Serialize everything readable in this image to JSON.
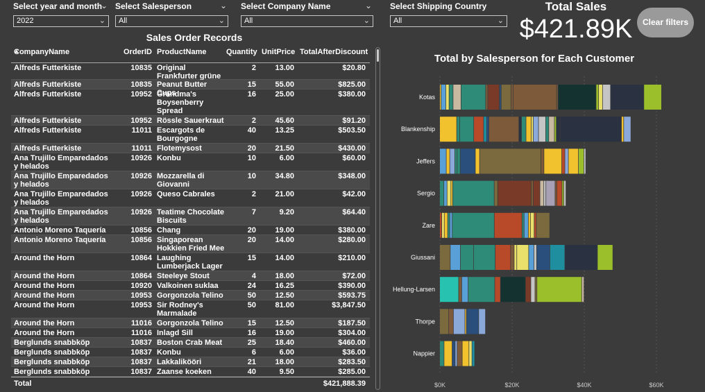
{
  "slicers": [
    {
      "label": "Select year and month",
      "value": "2022"
    },
    {
      "label": "Select Salesperson",
      "value": "All"
    },
    {
      "label": "Select Company Name",
      "value": "All"
    },
    {
      "label": "Select Shipping Country",
      "value": "All"
    }
  ],
  "kpi": {
    "label": "Total Sales",
    "value": "$421.89K"
  },
  "clear_button": "Clear filters",
  "table": {
    "title": "Sales Order Records",
    "columns": [
      "CompanyName",
      "OrderID",
      "ProductName",
      "Quantity",
      "UnitPrice",
      "TotalAfterDiscount"
    ],
    "rows": [
      {
        "company": "Alfreds Futterkiste",
        "id": "10835",
        "product": "Original Frankfurter grüne Soße",
        "qty": "2",
        "price": "13.00",
        "total": "$20.80"
      },
      {
        "company": "Alfreds Futterkiste",
        "id": "10835",
        "product": "Peanut Butter Cups",
        "qty": "15",
        "price": "55.00",
        "total": "$825.00"
      },
      {
        "company": "Alfreds Futterkiste",
        "id": "10952",
        "product": "Grandma's Boysenberry Spread",
        "qty": "16",
        "price": "25.00",
        "total": "$380.00"
      },
      {
        "company": "Alfreds Futterkiste",
        "id": "10952",
        "product": "Rössle Sauerkraut",
        "qty": "2",
        "price": "45.60",
        "total": "$91.20"
      },
      {
        "company": "Alfreds Futterkiste",
        "id": "11011",
        "product": "Escargots de Bourgogne",
        "qty": "40",
        "price": "13.25",
        "total": "$503.50"
      },
      {
        "company": "Alfreds Futterkiste",
        "id": "11011",
        "product": "Flotemysost",
        "qty": "20",
        "price": "21.50",
        "total": "$430.00"
      },
      {
        "company": "Ana Trujillo Emparedados y helados",
        "id": "10926",
        "product": "Konbu",
        "qty": "10",
        "price": "6.00",
        "total": "$60.00"
      },
      {
        "company": "Ana Trujillo Emparedados y helados",
        "id": "10926",
        "product": "Mozzarella di Giovanni",
        "qty": "10",
        "price": "34.80",
        "total": "$348.00"
      },
      {
        "company": "Ana Trujillo Emparedados y helados",
        "id": "10926",
        "product": "Queso Cabrales",
        "qty": "2",
        "price": "21.00",
        "total": "$42.00"
      },
      {
        "company": "Ana Trujillo Emparedados y helados",
        "id": "10926",
        "product": "Teatime Chocolate Biscuits",
        "qty": "7",
        "price": "9.20",
        "total": "$64.40"
      },
      {
        "company": "Antonio Moreno Taquería",
        "id": "10856",
        "product": "Chang",
        "qty": "20",
        "price": "19.00",
        "total": "$380.00"
      },
      {
        "company": "Antonio Moreno Taquería",
        "id": "10856",
        "product": "Singaporean Hokkien Fried Mee",
        "qty": "20",
        "price": "14.00",
        "total": "$280.00"
      },
      {
        "company": "Around the Horn",
        "id": "10864",
        "product": "Laughing Lumberjack Lager",
        "qty": "15",
        "price": "14.00",
        "total": "$210.00"
      },
      {
        "company": "Around the Horn",
        "id": "10864",
        "product": "Steeleye Stout",
        "qty": "4",
        "price": "18.00",
        "total": "$72.00"
      },
      {
        "company": "Around the Horn",
        "id": "10920",
        "product": "Valkoinen suklaa",
        "qty": "24",
        "price": "16.25",
        "total": "$390.00"
      },
      {
        "company": "Around the Horn",
        "id": "10953",
        "product": "Gorgonzola Telino",
        "qty": "50",
        "price": "12.50",
        "total": "$593.75"
      },
      {
        "company": "Around the Horn",
        "id": "10953",
        "product": "Sir Rodney's Marmalade",
        "qty": "50",
        "price": "81.00",
        "total": "$3,847.50"
      },
      {
        "company": "Around the Horn",
        "id": "11016",
        "product": "Gorgonzola Telino",
        "qty": "15",
        "price": "12.50",
        "total": "$187.50"
      },
      {
        "company": "Around the Horn",
        "id": "11016",
        "product": "Inlagd Sill",
        "qty": "16",
        "price": "19.00",
        "total": "$304.00"
      },
      {
        "company": "Berglunds snabbköp",
        "id": "10837",
        "product": "Boston Crab Meat",
        "qty": "25",
        "price": "18.40",
        "total": "$460.00"
      },
      {
        "company": "Berglunds snabbköp",
        "id": "10837",
        "product": "Konbu",
        "qty": "6",
        "price": "6.00",
        "total": "$36.00"
      },
      {
        "company": "Berglunds snabbköp",
        "id": "10837",
        "product": "Lakkalikööri",
        "qty": "21",
        "price": "18.00",
        "total": "$283.50"
      },
      {
        "company": "Berglunds snabbköp",
        "id": "10837",
        "product": "Zaanse koeken",
        "qty": "40",
        "price": "9.50",
        "total": "$285.00"
      }
    ],
    "total_label": "Total",
    "total_value": "$421,888.39"
  },
  "chart_data": {
    "type": "bar",
    "orientation": "horizontal",
    "stacked": true,
    "title": "Total by Salesperson for Each Customer",
    "categories": [
      "Kotas",
      "Blankenship",
      "Jeffers",
      "Sergio",
      "Zare",
      "Giussani",
      "Hellung-Larsen",
      "Thorpe",
      "Nappier"
    ],
    "x_ticks": [
      "$0K",
      "$20K",
      "$40K",
      "$60K"
    ],
    "xlim": [
      0,
      65000
    ],
    "totals": [
      61500,
      53000,
      40500,
      35000,
      30500,
      48000,
      40000,
      12700,
      9700
    ],
    "palette": [
      "#f2c12e",
      "#5aa0d8",
      "#2e8b78",
      "#b84a2a",
      "#7a6a3e",
      "#14322f",
      "#8aa8d8",
      "#c5c5c5",
      "#e8e06a",
      "#9bbf2a",
      "#2a3140",
      "#7c5a3a",
      "#2a4f7c",
      "#1f8fa0",
      "#a8a0b4",
      "#c9b9a1",
      "#7a3a28",
      "#27c3b0"
    ],
    "segments": [
      [
        [
          400,
          0
        ],
        [
          1300,
          1
        ],
        [
          900,
          8
        ],
        [
          1100,
          2
        ],
        [
          2200,
          15
        ],
        [
          6800,
          2
        ],
        [
          600,
          11
        ],
        [
          3200,
          16
        ],
        [
          500,
          12
        ],
        [
          2700,
          4
        ],
        [
          600,
          11
        ],
        [
          12000,
          11
        ],
        [
          400,
          11
        ],
        [
          10500,
          5
        ],
        [
          700,
          9
        ],
        [
          1100,
          8
        ],
        [
          2200,
          7
        ],
        [
          9200,
          10
        ],
        [
          4900,
          9
        ]
      ],
      [
        [
          4500,
          0
        ],
        [
          800,
          2
        ],
        [
          3700,
          2
        ],
        [
          2600,
          3
        ],
        [
          800,
          13
        ],
        [
          600,
          12
        ],
        [
          7900,
          11
        ],
        [
          700,
          10
        ],
        [
          1200,
          2
        ],
        [
          1400,
          0
        ],
        [
          500,
          8
        ],
        [
          1400,
          6
        ],
        [
          1900,
          7
        ],
        [
          800,
          2
        ],
        [
          1500,
          15
        ],
        [
          500,
          9
        ],
        [
          1000,
          10
        ],
        [
          16200,
          10
        ],
        [
          600,
          0
        ],
        [
          1900,
          6
        ]
      ],
      [
        [
          1700,
          1
        ],
        [
          900,
          0
        ],
        [
          1300,
          6
        ],
        [
          600,
          2
        ],
        [
          800,
          2
        ],
        [
          3900,
          12
        ],
        [
          1100,
          0
        ],
        [
          15800,
          4
        ],
        [
          800,
          11
        ],
        [
          4600,
          0
        ],
        [
          800,
          3
        ],
        [
          900,
          6
        ],
        [
          2600,
          0
        ],
        [
          1400,
          9
        ],
        [
          500,
          7
        ]
      ],
      [
        [
          1200,
          2
        ],
        [
          900,
          1
        ],
        [
          1100,
          8
        ],
        [
          500,
          0
        ],
        [
          11800,
          2
        ],
        [
          1000,
          4
        ],
        [
          9500,
          16
        ],
        [
          600,
          11
        ],
        [
          1900,
          16
        ],
        [
          1100,
          15
        ],
        [
          600,
          7
        ],
        [
          2600,
          14
        ],
        [
          500,
          11
        ],
        [
          1500,
          3
        ],
        [
          500,
          9
        ],
        [
          600,
          7
        ]
      ],
      [
        [
          500,
          3
        ],
        [
          600,
          8
        ],
        [
          800,
          0
        ],
        [
          500,
          2
        ],
        [
          600,
          1
        ],
        [
          10000,
          2
        ],
        [
          6600,
          3
        ],
        [
          500,
          2
        ],
        [
          1000,
          1
        ],
        [
          500,
          0
        ],
        [
          900,
          8
        ],
        [
          500,
          3
        ],
        [
          3200,
          4
        ]
      ],
      [
        [
          2400,
          4
        ],
        [
          2300,
          1
        ],
        [
          3000,
          2
        ],
        [
          4900,
          2
        ],
        [
          3500,
          3
        ],
        [
          800,
          11
        ],
        [
          600,
          8
        ],
        [
          2700,
          8
        ],
        [
          1200,
          1
        ],
        [
          600,
          7
        ],
        [
          3000,
          12
        ],
        [
          3400,
          13
        ],
        [
          7400,
          10
        ],
        [
          3500,
          9
        ]
      ],
      [
        [
          5000,
          17
        ],
        [
          800,
          11
        ],
        [
          1700,
          1
        ],
        [
          7000,
          2
        ],
        [
          1500,
          3
        ],
        [
          6600,
          5
        ],
        [
          1400,
          16
        ],
        [
          1100,
          7
        ],
        [
          500,
          4
        ],
        [
          11800,
          9
        ],
        [
          600,
          15
        ]
      ],
      [
        [
          2500,
          4
        ],
        [
          1300,
          11
        ],
        [
          3200,
          6
        ],
        [
          400,
          0
        ],
        [
          3400,
          12
        ],
        [
          1900,
          6
        ]
      ],
      [
        [
          1300,
          2
        ],
        [
          2400,
          0
        ],
        [
          900,
          12
        ],
        [
          600,
          6
        ],
        [
          1500,
          11
        ],
        [
          2000,
          0
        ],
        [
          900,
          8
        ],
        [
          800,
          13
        ]
      ]
    ]
  }
}
